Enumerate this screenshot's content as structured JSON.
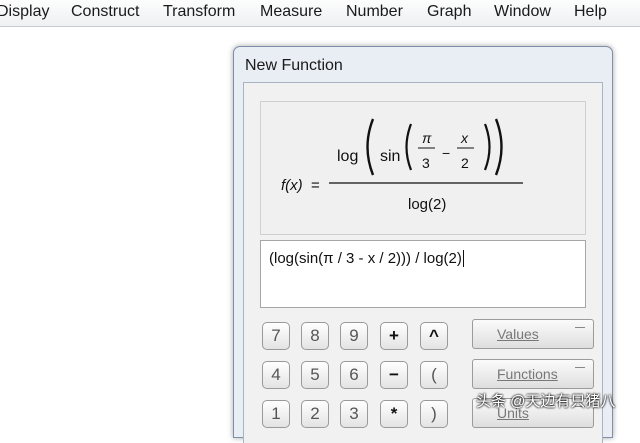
{
  "menu": [
    "Display",
    "Construct",
    "Transform",
    "Measure",
    "Number",
    "Graph",
    "Window",
    "Help"
  ],
  "dialog": {
    "title": "New Function",
    "formula": {
      "fx": "f(x)",
      "equals": "=",
      "log": "log",
      "sin": "sin",
      "pi": "π",
      "three": "3",
      "minus": "−",
      "x": "x",
      "two": "2",
      "denominator": "log(2)"
    },
    "input_value": "(log(sin(π / 3 - x / 2))) / log(2)",
    "keys": [
      "7",
      "8",
      "9",
      "+",
      "^",
      "4",
      "5",
      "6",
      "−",
      "(",
      "1",
      "2",
      "3",
      "*",
      ")"
    ],
    "buttons": {
      "values": "Values",
      "functions": "Functions",
      "units": "Units"
    }
  },
  "watermark": "头条 @天边有只猪八"
}
